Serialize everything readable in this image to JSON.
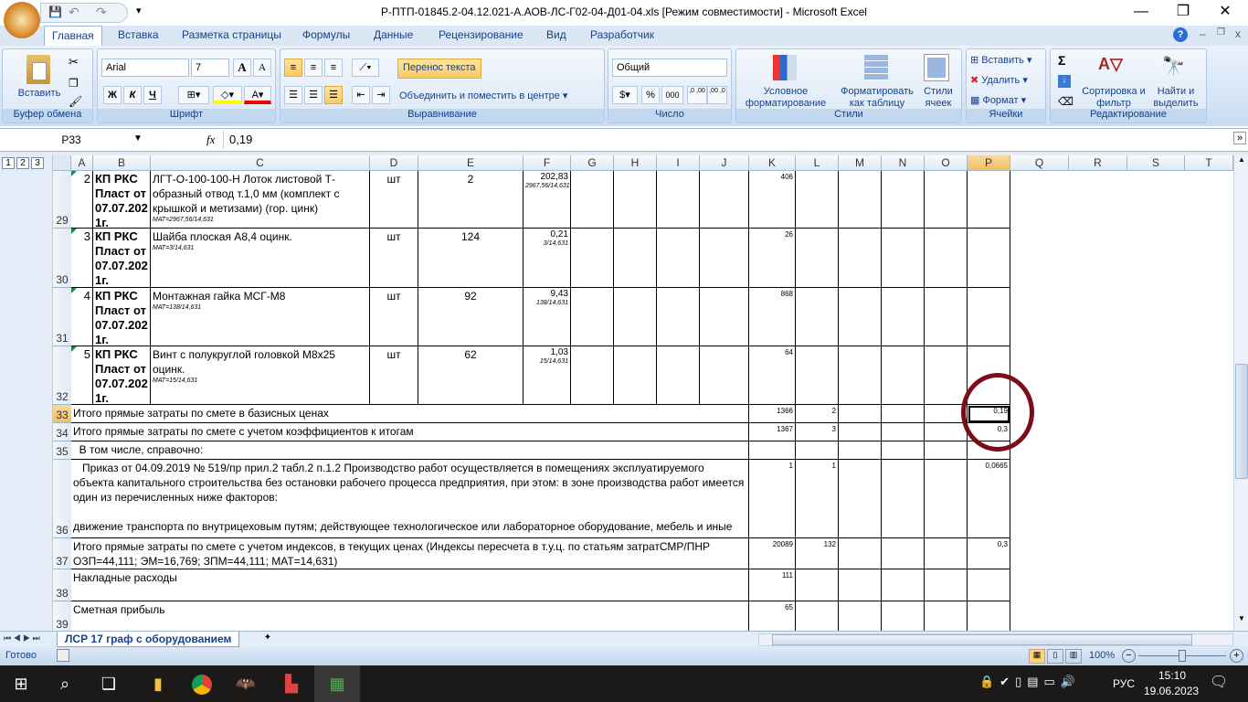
{
  "window": {
    "title": "Р-ПТП-01845.2-04.12.021-А.АОВ-ЛС-Г02-04-Д01-04.xls  [Режим совместимости] - Microsoft Excel",
    "minimize": "—",
    "restore": "❐",
    "close": "✕"
  },
  "quick_access": {
    "save": "💾",
    "undo": "↶",
    "redo": "↷"
  },
  "tabs": [
    {
      "label": "Главная",
      "active": true
    },
    {
      "label": "Вставка"
    },
    {
      "label": "Разметка страницы"
    },
    {
      "label": "Формулы"
    },
    {
      "label": "Данные"
    },
    {
      "label": "Рецензирование"
    },
    {
      "label": "Вид"
    },
    {
      "label": "Разработчик"
    }
  ],
  "ribbon": {
    "clipboard": {
      "label": "Буфер обмена",
      "paste": "Вставить"
    },
    "font": {
      "label": "Шрифт",
      "name": "Arial",
      "size": "7",
      "bold": "Ж",
      "italic": "К",
      "underline": "Ч",
      "grow": "A",
      "shrink": "A"
    },
    "alignment": {
      "label": "Выравнивание",
      "wrap": "Перенос текста",
      "merge": "Объединить и поместить в центре"
    },
    "number": {
      "label": "Число",
      "format": "Общий",
      "percent": "%",
      "thousands": "000",
      "inc_dec": ",0 ,00",
      "dec_dec": ",00 ,0"
    },
    "styles": {
      "label": "Стили",
      "conditional": "Условное форматирование",
      "as_table": "Форматировать как таблицу",
      "cell_styles": "Стили ячеек"
    },
    "cells": {
      "label": "Ячейки",
      "insert": "Вставить",
      "delete": "Удалить",
      "format": "Формат"
    },
    "editing": {
      "label": "Редактирование",
      "sum": "Σ",
      "sort": "Сортировка и фильтр",
      "find": "Найти и выделить"
    }
  },
  "formula_bar": {
    "name_box": "P33",
    "fx": "fx",
    "value": "0,19"
  },
  "outline_levels": [
    "1",
    "2",
    "3"
  ],
  "columns": [
    "A",
    "B",
    "C",
    "D",
    "E",
    "F",
    "G",
    "H",
    "I",
    "J",
    "K",
    "L",
    "M",
    "N",
    "O",
    "P",
    "Q",
    "R",
    "S",
    "T"
  ],
  "selected_cell": "P33",
  "rows": [
    {
      "num": "29",
      "a": "2",
      "b": "КП РКС Пласт от 07.07.2021г.",
      "c": "ЛГТ-О-100-100-Н Лоток листовой Т-образный отвод т.1,0 мм (комплект с крышкой и метизами) (гор. цинк)",
      "c_note": "МАТ=2967,56/14,631",
      "d": "шт",
      "e": "2",
      "f": "202,83",
      "f_note": "2967,56/14,631",
      "k": "406"
    },
    {
      "num": "30",
      "a": "3",
      "b": "КП РКС Пласт от 07.07.2021г.",
      "c": "Шайба плоская А8,4 оцинк.",
      "c_note": "МАТ=3/14,631",
      "d": "шт",
      "e": "124",
      "f": "0,21",
      "f_note": "3/14,631",
      "k": "26"
    },
    {
      "num": "31",
      "a": "4",
      "b": "КП РКС Пласт от 07.07.2021г.",
      "c": "Монтажная гайка МСГ-М8",
      "c_note": "МАТ=138/14,631",
      "d": "шт",
      "e": "92",
      "f": "9,43",
      "f_note": "138/14,631",
      "k": "868"
    },
    {
      "num": "32",
      "a": "5",
      "b": "КП РКС Пласт от 07.07.2021г.",
      "c": "Винт с полукруглой головкой М8х25 оцинк.",
      "c_note": "МАТ=15/14,631",
      "d": "шт",
      "e": "62",
      "f": "1,03",
      "f_note": "15/14,631",
      "k": "64"
    },
    {
      "num": "33",
      "text": "Итого прямые затраты по смете в базисных ценах",
      "k": "1366",
      "l": "2",
      "p": "0,19"
    },
    {
      "num": "34",
      "text": "Итого прямые затраты по смете с учетом коэффициентов к итогам",
      "k": "1367",
      "l": "3",
      "p": "0,3"
    },
    {
      "num": "35",
      "text": "  В том числе, справочно:"
    },
    {
      "num": "36",
      "text": "   Приказ от 04.09.2019 № 519/пр прил.2 табл.2 п.1.2 Производство работ осуществляется в помещениях эксплуатируемого объекта капитального строительства без остановки рабочего процесса предприятия, при этом: в зоне производства работ имеется один из перечисленных ниже факторов:\n\nдвижение транспорта по внутрицеховым путям; действующее технологическое или лабораторное оборудование, мебель и иные",
      "k": "1",
      "l": "1",
      "p": "0,0665"
    },
    {
      "num": "37",
      "text": "Итого прямые затраты по смете с учетом индексов, в текущих ценах (Индексы пересчета в т.у.ц. по статьям затратСМР/ПНР ОЗП=44,111; ЭМ=16,769; ЗПМ=44,111; МАТ=14,631)",
      "k": "20089",
      "l": "132",
      "p": "0,3"
    },
    {
      "num": "38",
      "text": "Накладные расходы",
      "k": "111"
    },
    {
      "num": "39",
      "text": "Сметная прибыль",
      "k": "65"
    }
  ],
  "annotation_color": "#7b0c1a",
  "sheet_tabs": [
    {
      "label": "ЛСР 17 граф с оборудованием",
      "active": true
    }
  ],
  "status": {
    "ready": "Готово",
    "zoom": "100%"
  },
  "taskbar": {
    "lang": "РУС",
    "time": "15:10",
    "date": "19.06.2023"
  }
}
